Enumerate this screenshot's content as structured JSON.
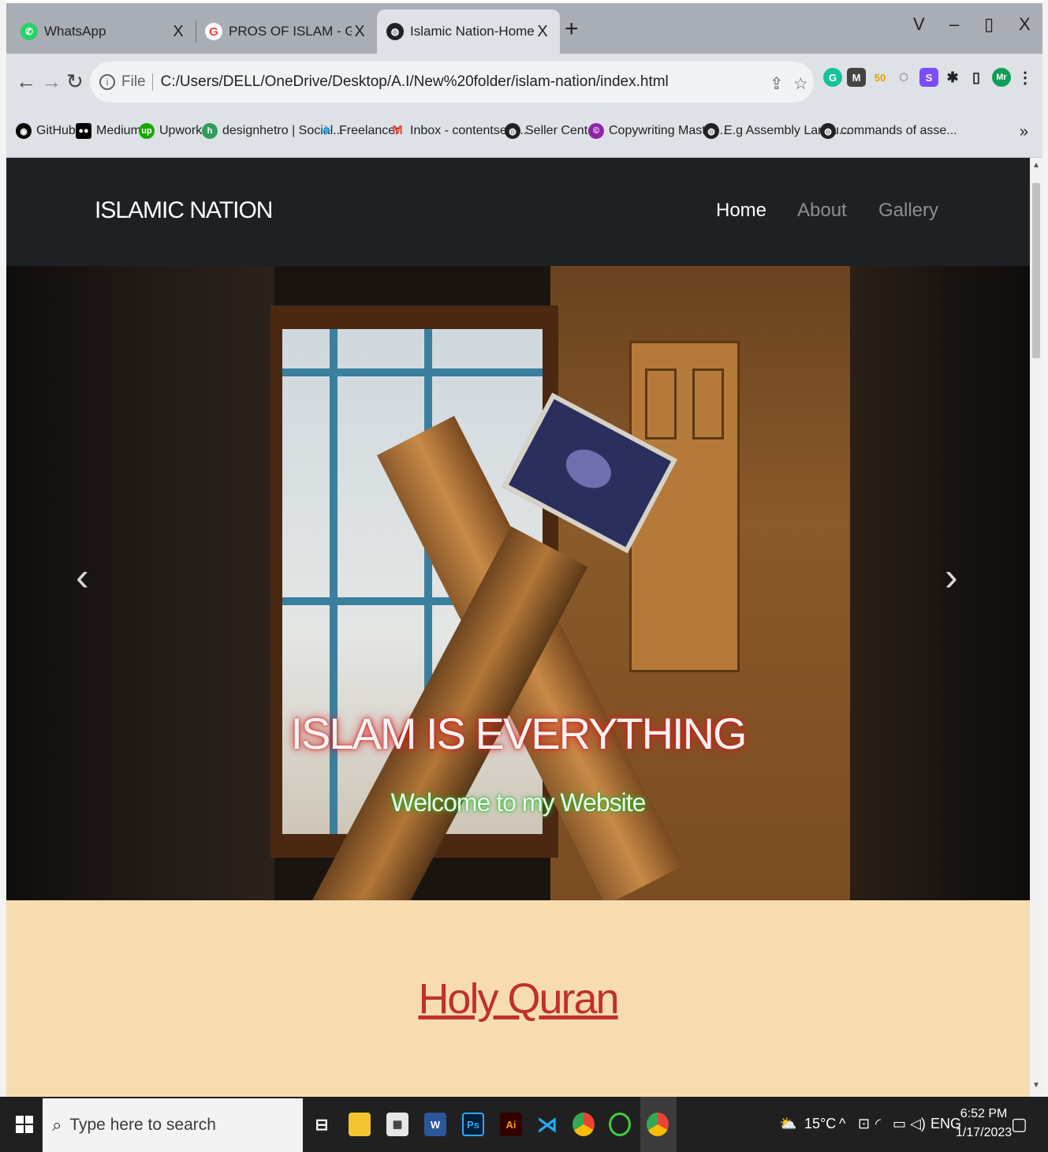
{
  "tabs": [
    {
      "title": "WhatsApp",
      "close": "X",
      "icon": "whatsapp-icon",
      "color": "#25d366"
    },
    {
      "title": "PROS OF ISLAM - Google Search",
      "close": "X",
      "icon": "google-icon",
      "color": "#ea4335"
    },
    {
      "title": "Islamic Nation-Home",
      "close": "X",
      "icon": "globe-icon",
      "color": "#202124"
    }
  ],
  "window": {
    "new_tab": "+",
    "tab_search": "V",
    "minimize": "–",
    "maximize": "▯",
    "close": "X"
  },
  "address": {
    "scheme_label": "File",
    "url": "C:/Users/DELL/OneDrive/Desktop/A.I/New%20folder/islam-nation/index.html"
  },
  "bookmarks": [
    {
      "label": "GitHub",
      "icon": "github-icon",
      "color": "#000000"
    },
    {
      "label": "Medium",
      "icon": "medium-icon",
      "color": "#000000"
    },
    {
      "label": "Upwork",
      "icon": "upwork-icon",
      "color": "#14a800"
    },
    {
      "label": "designhetro | Social...",
      "icon": "designhetro-icon",
      "color": "#2e9e5b"
    },
    {
      "label": "Freelancer",
      "icon": "freelancer-icon",
      "color": "#29b2fe"
    },
    {
      "label": "Inbox - contentserv...",
      "icon": "gmail-icon",
      "color": "#ea4335"
    },
    {
      "label": "Seller Center",
      "icon": "globe-icon",
      "color": "#202124"
    },
    {
      "label": "Copywriting Master...",
      "icon": "copywriting-icon",
      "color": "#8e24aa"
    },
    {
      "label": "E.g Assembly Langu...",
      "icon": "globe-icon",
      "color": "#202124"
    },
    {
      "label": "commands of asse...",
      "icon": "globe-icon",
      "color": "#202124"
    }
  ],
  "bookmarks_more": "»",
  "site": {
    "brand": "ISLAMIC NATION",
    "nav": [
      {
        "label": "Home",
        "active": true
      },
      {
        "label": "About",
        "active": false
      },
      {
        "label": "Gallery",
        "active": false
      }
    ],
    "hero_title": "ISLAM IS EVERYTHING",
    "hero_subtitle": "Welcome to my Website",
    "prev": "‹",
    "next": "›",
    "section_title": "Holy Quran"
  },
  "taskbar": {
    "search_placeholder": "Type here to search",
    "weather": "15°C",
    "language": "ENG",
    "time": "6:52 PM",
    "date": "1/17/2023"
  },
  "colors": {
    "nav_bg": "#1e2124",
    "page_bg": "#f7dcaf",
    "section_title": "#c0302d"
  }
}
